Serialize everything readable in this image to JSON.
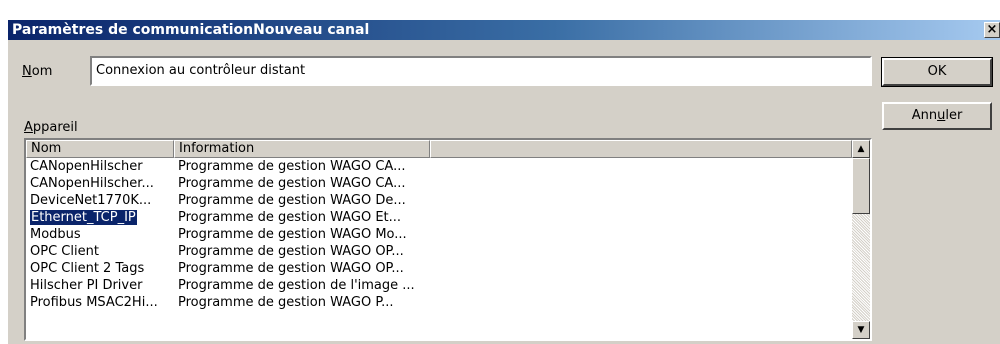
{
  "window": {
    "title": "Paramètres de communicationNouveau canal",
    "close_glyph": "×",
    "title_color": "#0a246a"
  },
  "name_field": {
    "label_hotkey": "N",
    "label_rest": "om",
    "value": "Connexion au contrôleur distant"
  },
  "buttons": {
    "ok_label": "OK",
    "cancel_label_pre": "Ann",
    "cancel_label_hotkey": "u",
    "cancel_label_post": "ler"
  },
  "device": {
    "label_hotkey": "A",
    "label_rest": "ppareil",
    "columns": [
      "Nom",
      "Information",
      ""
    ],
    "rows": [
      {
        "name": "CANopenHilscher",
        "info": "Programme de gestion WAGO CA..."
      },
      {
        "name": "CANopenHilscher...",
        "info": "Programme de gestion WAGO CA..."
      },
      {
        "name": "DeviceNet1770K...",
        "info": "Programme de gestion WAGO De..."
      },
      {
        "name": "Ethernet_TCP_IP",
        "info": "Programme de gestion WAGO Et..."
      },
      {
        "name": "Modbus",
        "info": "Programme de gestion WAGO Mo..."
      },
      {
        "name": "OPC Client",
        "info": "Programme de gestion WAGO OP..."
      },
      {
        "name": "OPC Client 2 Tags",
        "info": "Programme de gestion WAGO OP..."
      },
      {
        "name": "Hilscher PI Driver",
        "info": "Programme de gestion de l'image ..."
      },
      {
        "name": "Profibus MSAC2Hi...",
        "info": "Programme de gestion WAGO P..."
      }
    ],
    "selected_row": "Ethernet_TCP_IP",
    "selection_color": "#0a246a"
  },
  "scrollbar": {
    "up_glyph": "▲",
    "down_glyph": "▼"
  }
}
